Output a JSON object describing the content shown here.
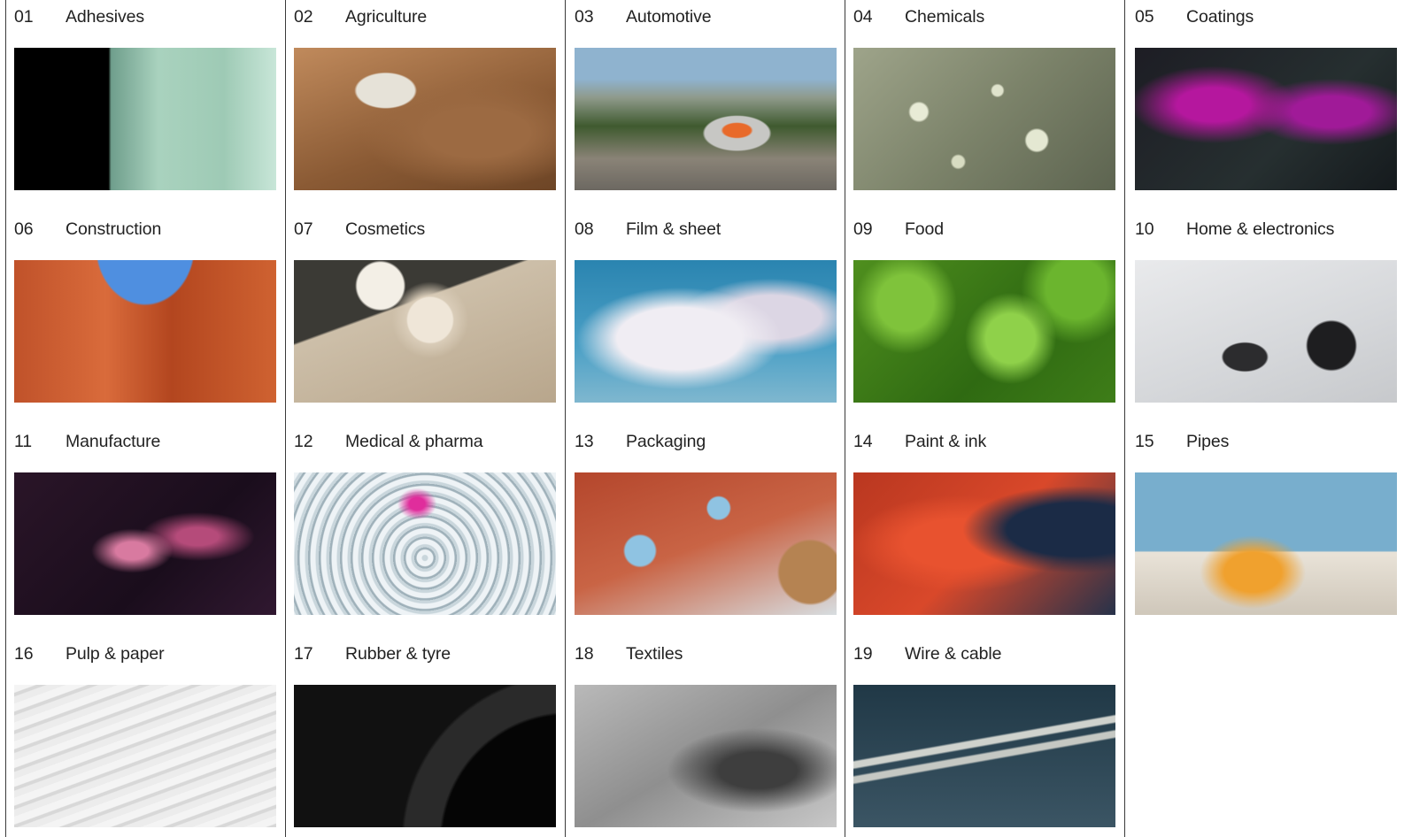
{
  "industries": [
    {
      "num": "01",
      "label": "Adhesives"
    },
    {
      "num": "02",
      "label": "Agriculture"
    },
    {
      "num": "03",
      "label": "Automotive"
    },
    {
      "num": "04",
      "label": "Chemicals"
    },
    {
      "num": "05",
      "label": "Coatings"
    },
    {
      "num": "06",
      "label": "Construction"
    },
    {
      "num": "07",
      "label": "Cosmetics"
    },
    {
      "num": "08",
      "label": "Film & sheet"
    },
    {
      "num": "09",
      "label": "Food"
    },
    {
      "num": "10",
      "label": "Home & electronics"
    },
    {
      "num": "11",
      "label": "Manufacture"
    },
    {
      "num": "12",
      "label": "Medical & pharma"
    },
    {
      "num": "13",
      "label": "Packaging"
    },
    {
      "num": "14",
      "label": "Paint & ink"
    },
    {
      "num": "15",
      "label": "Pipes"
    },
    {
      "num": "16",
      "label": "Pulp & paper"
    },
    {
      "num": "17",
      "label": "Rubber & tyre"
    },
    {
      "num": "18",
      "label": "Textiles"
    },
    {
      "num": "19",
      "label": "Wire & cable"
    }
  ]
}
